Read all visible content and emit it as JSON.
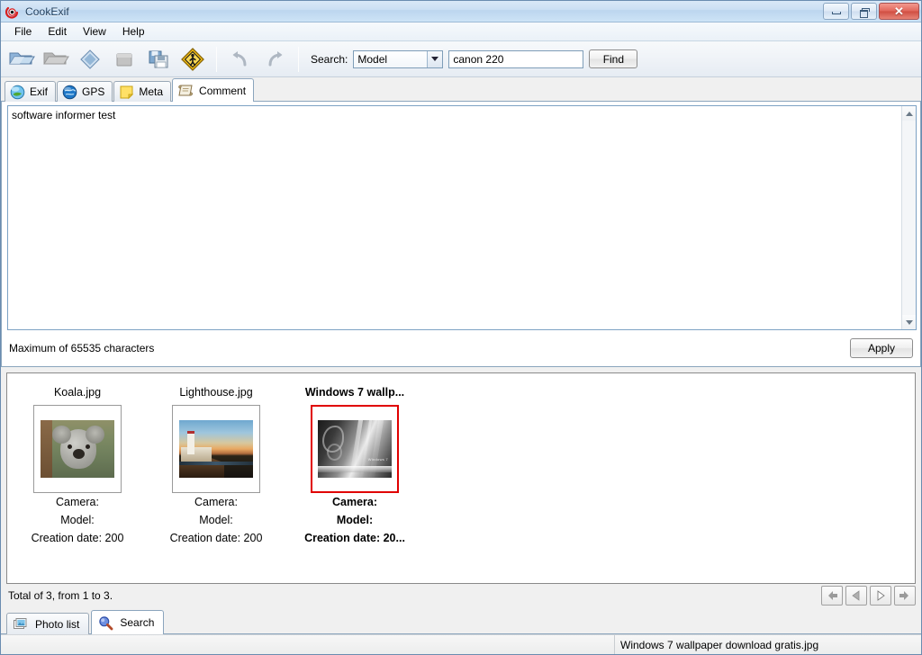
{
  "window": {
    "title": "CookExif",
    "app_icon": "cookexif-logo-icon",
    "controls": {
      "minimize": "minimize-button",
      "restore": "restore-button",
      "close": "close-button",
      "close_glyph": "✕"
    }
  },
  "menubar": {
    "items": [
      {
        "label": "File"
      },
      {
        "label": "Edit"
      },
      {
        "label": "View"
      },
      {
        "label": "Help"
      }
    ]
  },
  "toolbar": {
    "buttons": [
      {
        "name": "open-folder-button",
        "icon": "blue-folder-icon"
      },
      {
        "name": "open-folder-disabled-button",
        "icon": "gray-folder-icon"
      },
      {
        "name": "single-file-button",
        "icon": "blue-diamond-file-icon"
      },
      {
        "name": "stop-button",
        "icon": "gray-square-icon"
      },
      {
        "name": "save-button",
        "icon": "save-disk-icon"
      },
      {
        "name": "pedestrian-button",
        "icon": "pedestrian-warning-icon"
      },
      {
        "name": "undo-button",
        "icon": "undo-arrow-icon"
      },
      {
        "name": "redo-button",
        "icon": "redo-arrow-icon"
      }
    ],
    "search": {
      "label": "Search:",
      "field_selected": "Model",
      "field_options": [
        "Model"
      ],
      "query_value": "canon 220",
      "query_placeholder": "",
      "find_label": "Find",
      "dropdown_icon": "chevron-down-icon"
    }
  },
  "tabs": {
    "items": [
      {
        "label": "Exif",
        "icon": "exif-globe-icon",
        "active": false
      },
      {
        "label": "GPS",
        "icon": "gps-globe-icon",
        "active": false
      },
      {
        "label": "Meta",
        "icon": "meta-note-icon",
        "active": false
      },
      {
        "label": "Comment",
        "icon": "comment-scroll-icon",
        "active": true
      }
    ]
  },
  "comment_panel": {
    "text": "software informer test",
    "placeholder": "",
    "max_chars_note": "Maximum of 65535 characters",
    "apply_label": "Apply",
    "scrollbar": {
      "up_icon": "scroll-up-arrow-icon",
      "down_icon": "scroll-down-arrow-icon"
    }
  },
  "photo_list": {
    "photos": [
      {
        "name": "Koala.jpg",
        "art": "koala",
        "selected": false,
        "meta": [
          "Camera:",
          "Model:",
          "Creation date: 200"
        ]
      },
      {
        "name": "Lighthouse.jpg",
        "art": "lighthouse",
        "selected": false,
        "meta": [
          "Camera:",
          "Model:",
          "Creation date: 200"
        ]
      },
      {
        "name": "Windows 7 wallp...",
        "art": "win7",
        "selected": true,
        "meta": [
          "Camera:",
          "Model:",
          "Creation date: 20..."
        ]
      }
    ],
    "status_text": "Total of 3, from 1 to 3.",
    "nav_buttons": [
      {
        "name": "first-page-button",
        "icon": "arrow-first-icon"
      },
      {
        "name": "previous-page-button",
        "icon": "arrow-previous-icon"
      },
      {
        "name": "next-page-button",
        "icon": "arrow-next-icon"
      },
      {
        "name": "last-page-button",
        "icon": "arrow-last-icon"
      }
    ]
  },
  "bottom_tabs": {
    "items": [
      {
        "label": "Photo list",
        "icon": "photos-stack-icon",
        "active": false
      },
      {
        "label": "Search",
        "icon": "magnifier-icon",
        "active": true
      }
    ]
  },
  "statusbar": {
    "left_text": "",
    "right_text": "Windows 7 wallpaper download gratis.jpg"
  },
  "colors": {
    "titlebar_blue": "#cbdff3",
    "selection_red": "#e00000",
    "close_red": "#d04e42",
    "accent_yellow": "#f5c518"
  }
}
